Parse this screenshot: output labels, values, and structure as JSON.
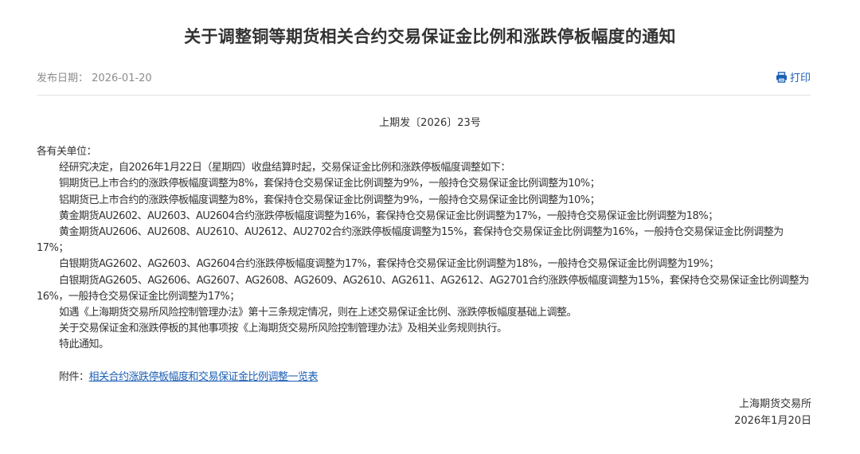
{
  "document": {
    "title": "关于调整铜等期货相关合约交易保证金比例和涨跌停板幅度的通知",
    "publish_label": "发布日期：",
    "publish_date": "2026-01-20",
    "print_label": "打印",
    "doc_number": "上期发〔2026〕23号",
    "salutation": "各有关单位：",
    "paragraphs": [
      "经研究决定，自2026年1月22日（星期四）收盘结算时起，交易保证金比例和涨跌停板幅度调整如下：",
      "铜期货已上市合约的涨跌停板幅度调整为8%，套保持仓交易保证金比例调整为9%，一般持仓交易保证金比例调整为10%；",
      "铝期货已上市合约的涨跌停板幅度调整为8%，套保持仓交易保证金比例调整为9%，一般持仓交易保证金比例调整为10%；",
      "黄金期货AU2602、AU2603、AU2604合约涨跌停板幅度调整为16%，套保持仓交易保证金比例调整为17%，一般持仓交易保证金比例调整为18%；",
      "黄金期货AU2606、AU2608、AU2610、AU2612、AU2702合约涨跌停板幅度调整为15%，套保持仓交易保证金比例调整为16%，一般持仓交易保证金比例调整为17%；",
      "白银期货AG2602、AG2603、AG2604合约涨跌停板幅度调整为17%，套保持仓交易保证金比例调整为18%，一般持仓交易保证金比例调整为19%；",
      "白银期货AG2605、AG2606、AG2607、AG2608、AG2609、AG2610、AG2611、AG2612、AG2701合约涨跌停板幅度调整为15%，套保持仓交易保证金比例调整为16%，一般持仓交易保证金比例调整为17%；",
      "如遇《上海期货交易所风险控制管理办法》第十三条规定情况，则在上述交易保证金比例、涨跌停板幅度基础上调整。",
      "关于交易保证金和涨跌停板的其他事项按《上海期货交易所风险控制管理办法》及相关业务规则执行。",
      "特此通知。"
    ],
    "attachment_label": "附件：",
    "attachment_link": "相关合约涨跌停板幅度和交易保证金比例调整一览表",
    "signer": "上海期货交易所",
    "sign_date": "2026年1月20日"
  },
  "colors": {
    "link": "#1c5fb6",
    "text": "#333333",
    "meta": "#8c8c8c",
    "divider": "#e3e3e3"
  },
  "icons": {
    "print": "printer-icon"
  }
}
